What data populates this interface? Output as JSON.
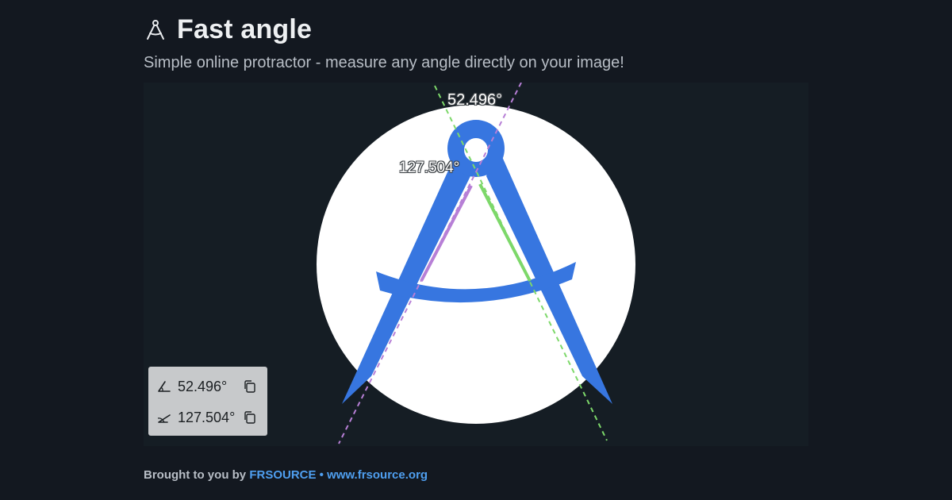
{
  "header": {
    "title": "Fast angle",
    "subtitle": "Simple online protractor - measure any angle directly on your image!",
    "logo_icon": "compass-icon"
  },
  "measurement": {
    "acute_angle": "52.496°",
    "obtuse_angle": "127.504°"
  },
  "readout": {
    "acute_value": "52.496°",
    "obtuse_value": "127.504°",
    "acute_icon": "acute-angle-icon",
    "obtuse_icon": "obtuse-angle-icon",
    "copy_icon": "copy-icon"
  },
  "footer": {
    "prefix": "Brought to you by",
    "brand": "FRSOURCE",
    "separator": "•",
    "site": "www.frsource.org"
  },
  "colors": {
    "background": "#131820",
    "canvas": "#151d24",
    "logo_blue": "#3776e0",
    "line_green": "#7dd86a",
    "line_purple": "#b77fd6",
    "link": "#4f9ff0"
  }
}
